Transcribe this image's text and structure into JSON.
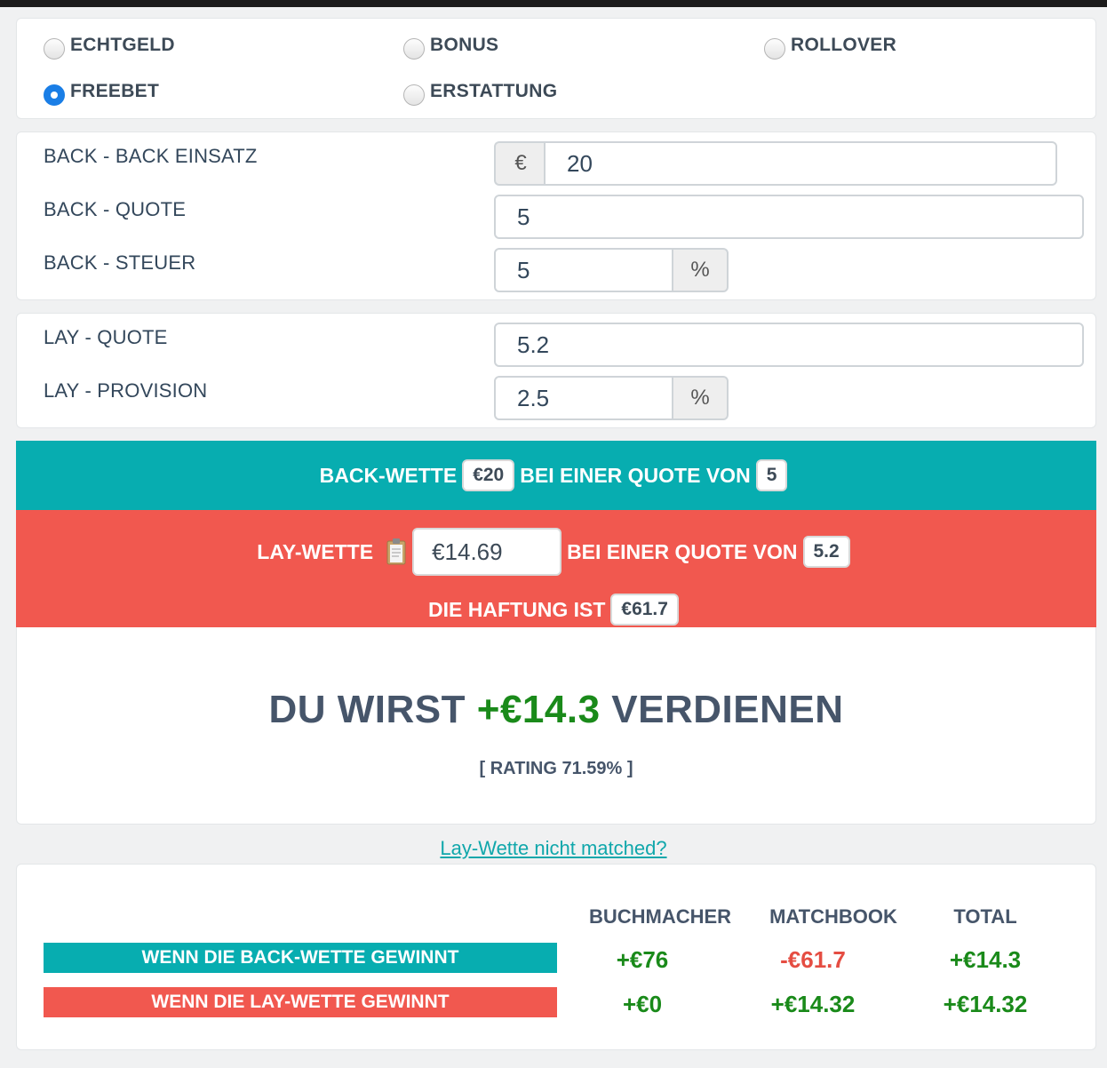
{
  "bet_types": [
    {
      "label": "ECHTGELD",
      "checked": false
    },
    {
      "label": "BONUS",
      "checked": false
    },
    {
      "label": "ROLLOVER",
      "checked": false
    },
    {
      "label": "FREEBET",
      "checked": true
    },
    {
      "label": "ERSTATTUNG",
      "checked": false
    }
  ],
  "back": {
    "stake_label": "BACK - BACK EINSATZ",
    "currency": "€",
    "stake_value": "20",
    "odds_label": "BACK - QUOTE",
    "odds_value": "5",
    "tax_label": "BACK - STEUER",
    "tax_value": "5",
    "tax_unit": "%"
  },
  "lay": {
    "odds_label": "LAY - QUOTE",
    "odds_value": "5.2",
    "commission_label": "LAY - PROVISION",
    "commission_value": "2.5",
    "commission_unit": "%"
  },
  "back_bar": {
    "prefix": "BACK-WETTE",
    "stake": "€20",
    "middle": "BEI EINER QUOTE VON",
    "odds": "5"
  },
  "lay_bar": {
    "prefix": "LAY-WETTE",
    "stake": "€14.69",
    "middle": "BEI EINER QUOTE VON",
    "odds": "5.2",
    "liability_label": "DIE HAFTUNG IST",
    "liability": "€61.7"
  },
  "result": {
    "prefix": "DU WIRST",
    "profit": "+€14.3",
    "suffix": "VERDIENEN",
    "rating": "[ RATING 71.59% ]"
  },
  "link_text": "Lay-Wette nicht matched?",
  "outcome_table": {
    "headers": [
      "BUCHMACHER",
      "MATCHBOOK",
      "TOTAL"
    ],
    "rows": [
      {
        "label": "WENN DIE BACK-WETTE GEWINNT",
        "values": [
          "+€76",
          "-€61.7",
          "+€14.3"
        ]
      },
      {
        "label": "WENN DIE LAY-WETTE GEWINNT",
        "values": [
          "+€0",
          "+€14.32",
          "+€14.32"
        ]
      }
    ]
  },
  "colors": {
    "teal": "#07adb0",
    "coral": "#f1584f",
    "positive": "#1a8a1a",
    "negative": "#e54d42",
    "radio_checked": "#1a7ee6"
  }
}
